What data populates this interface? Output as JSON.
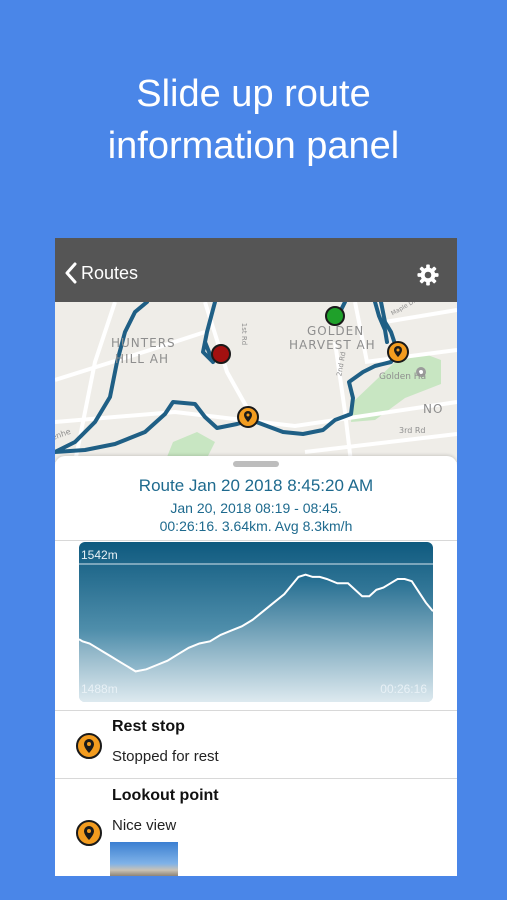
{
  "promo": {
    "line1": "Slide up route",
    "line2": "information panel"
  },
  "navbar": {
    "back_label": "Routes",
    "back_icon": "chevron-left-icon",
    "settings_icon": "gear-icon",
    "background": "#555555"
  },
  "map": {
    "labels": [
      "HUNTERS",
      "HILL AH",
      "GOLDEN",
      "HARVEST AH",
      "1st Rd",
      "2nd Rd",
      "3rd Rd",
      "Golden Ha",
      "Maple Dr",
      "NO",
      "enhe"
    ],
    "track_color": "#1f5f85",
    "start_color": "#1fa02a",
    "end_color": "#a31010",
    "poi_color": "#f39c1f"
  },
  "route": {
    "title": "Route Jan 20 2018 8:45:20 AM",
    "dates": "Jan 20, 2018 08:19 - 08:45.",
    "stats": "00:26:16. 3.64km. Avg 8.3km/h"
  },
  "elevation": {
    "max_label": "1542m",
    "min_label": "1488m",
    "duration_label": "00:26:16"
  },
  "chart_data": {
    "type": "area",
    "title": "",
    "ylabel": "",
    "xlabel": "",
    "ylim": [
      1488,
      1542
    ],
    "x": [
      0,
      0.01,
      0.03,
      0.05,
      0.07,
      0.09,
      0.11,
      0.14,
      0.16,
      0.19,
      0.22,
      0.25,
      0.28,
      0.31,
      0.34,
      0.37,
      0.4,
      0.43,
      0.46,
      0.49,
      0.52,
      0.55,
      0.58,
      0.6,
      0.62,
      0.64,
      0.66,
      0.68,
      0.7,
      0.73,
      0.76,
      0.78,
      0.8,
      0.82,
      0.84,
      0.86,
      0.88,
      0.9,
      0.92,
      0.94,
      0.96,
      0.98,
      1.0
    ],
    "values": [
      1507,
      1506,
      1505,
      1503,
      1501,
      1499,
      1497,
      1494,
      1492,
      1493,
      1495,
      1497,
      1500,
      1503,
      1505,
      1506,
      1509,
      1511,
      1513,
      1516,
      1520,
      1524,
      1528,
      1532,
      1536,
      1537,
      1536,
      1536,
      1535,
      1533,
      1533,
      1530,
      1527,
      1527,
      1530,
      1531,
      1533,
      1535,
      1535,
      1534,
      1529,
      1524,
      1520
    ]
  },
  "pois": [
    {
      "title": "Rest stop",
      "text": "Stopped for rest",
      "icon": "map-pin-icon"
    },
    {
      "title": "Lookout point",
      "text": "Nice view",
      "icon": "map-pin-icon"
    }
  ]
}
